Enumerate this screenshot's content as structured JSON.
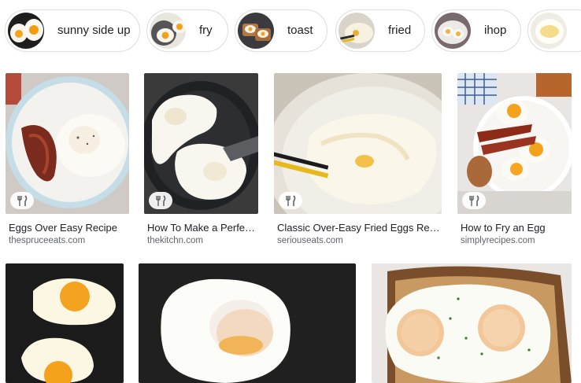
{
  "chips": [
    {
      "label": "sunny side up",
      "icon": "sunny-egg-thumbnail"
    },
    {
      "label": "fry",
      "icon": "fried-egg-thumbnail"
    },
    {
      "label": "toast",
      "icon": "egg-toast-thumbnail"
    },
    {
      "label": "fried",
      "icon": "fried-eggs-thumbnail"
    },
    {
      "label": "ihop",
      "icon": "ihop-eggs-thumbnail"
    },
    {
      "label": "",
      "icon": "egg-plate-thumbnail"
    }
  ],
  "results": [
    {
      "title": "Eggs Over Easy Recipe",
      "site": "thespruceeats.com",
      "icon": "recipe-utensils-icon"
    },
    {
      "title": "How To Make a Perfect…",
      "site": "thekitchn.com",
      "icon": "recipe-utensils-icon"
    },
    {
      "title": "Classic Over-Easy Fried Eggs Recip…",
      "site": "seriouseats.com",
      "icon": "recipe-utensils-icon"
    },
    {
      "title": "How to Fry an Egg",
      "site": "simplyrecipes.com",
      "icon": "recipe-utensils-icon"
    }
  ],
  "colors": {
    "chip_border": "#dadce0",
    "title_text": "#202124",
    "site_text": "#5f6368",
    "yolk": "#f6a623",
    "egg_white": "#fbf8ef",
    "pan": "#2b2b2b"
  }
}
